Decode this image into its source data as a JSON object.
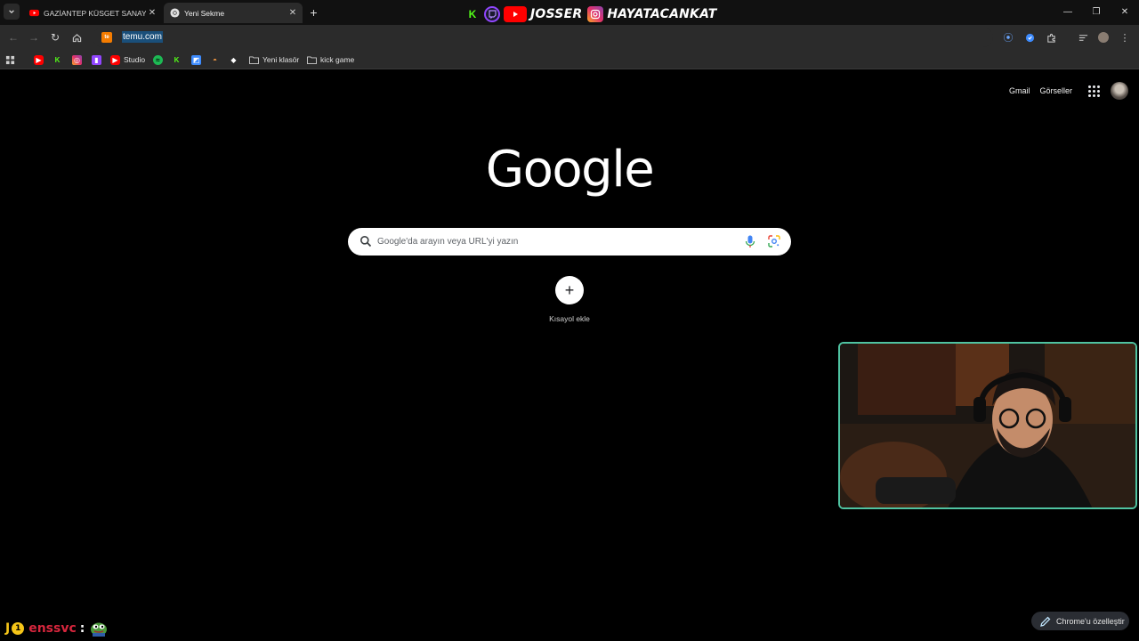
{
  "tabs": [
    {
      "title": "GAZİANTEP KÜSGET SANAYİ LE",
      "favicon": "youtube-icon"
    },
    {
      "title": "Yeni Sekme",
      "favicon": "chrome-icon"
    }
  ],
  "overlay": {
    "name1": "JOSSER",
    "name2": "HAYATACANKAT"
  },
  "toolbar": {
    "url": "temu.com"
  },
  "bookmarks": {
    "studio": "Studio",
    "folder1": "Yeni klasör",
    "folder2": "kick game"
  },
  "ntp": {
    "gmail": "Gmail",
    "images": "Görseller",
    "logo": "Google",
    "search_placeholder": "Google'da arayın veya URL'yi yazın",
    "shortcut_label": "Kısayol ekle",
    "customize": "Chrome'u özelleştir"
  },
  "chat": {
    "badge": "J",
    "badge_count": "1",
    "username": "enssvc",
    "separator": ":"
  },
  "colors": {
    "accent_webcam_border": "#4fc3a1",
    "chat_username": "#d7263d",
    "kick_green": "#53fc18",
    "youtube_red": "#ff0000",
    "twitch_purple": "#9146ff"
  }
}
